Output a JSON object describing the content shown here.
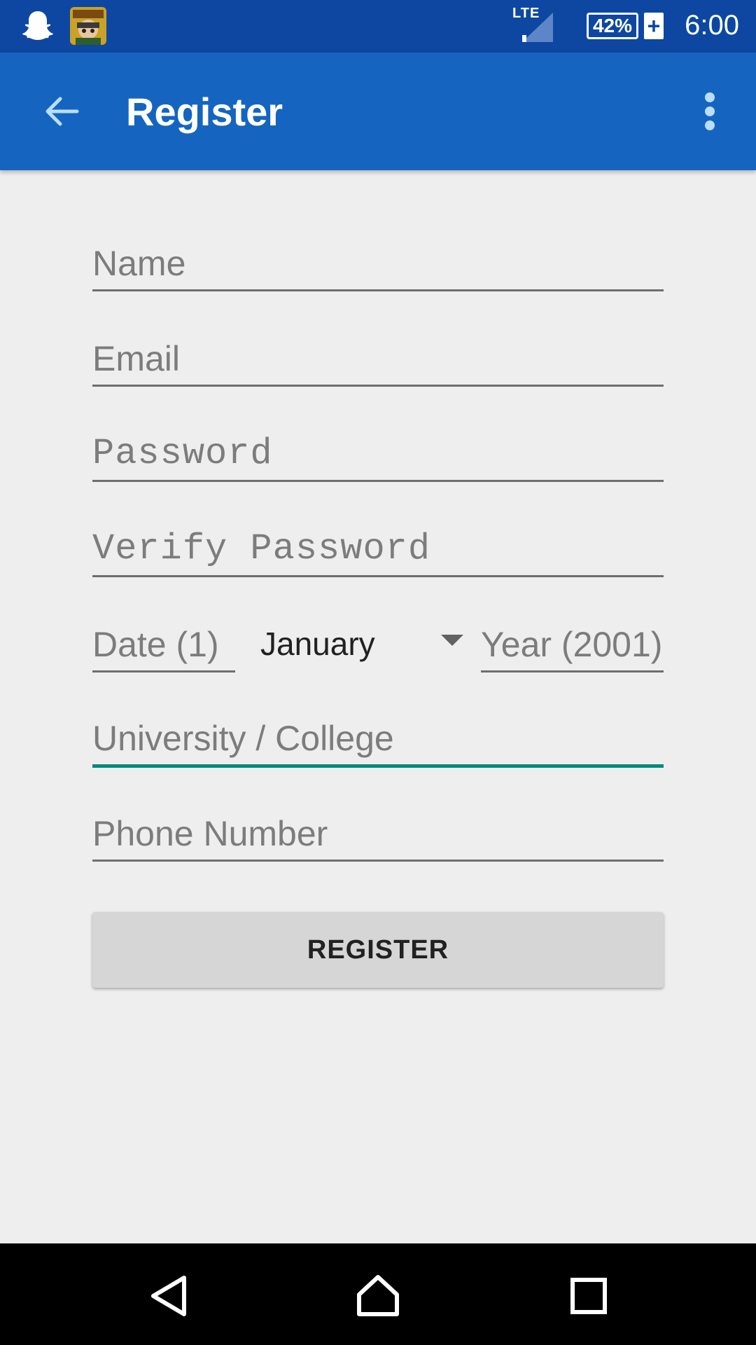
{
  "status_bar": {
    "network_label": "LTE",
    "battery_text": "42%",
    "battery_charging_symbol": "+",
    "time": "6:00",
    "icons": [
      "snapchat-icon",
      "game-app-icon",
      "signal-icon",
      "battery-icon"
    ]
  },
  "app_bar": {
    "title": "Register",
    "back_icon": "arrow-left-icon",
    "menu_icon": "more-vert-icon",
    "color": "#1565c0",
    "status_color": "#0d47a1"
  },
  "form": {
    "name": {
      "placeholder": "Name",
      "value": ""
    },
    "email": {
      "placeholder": "Email",
      "value": ""
    },
    "password": {
      "placeholder": "Password",
      "value": ""
    },
    "verify_password": {
      "placeholder": "Verify Password",
      "value": ""
    },
    "date": {
      "placeholder": "Date (1)",
      "value": ""
    },
    "month": {
      "selected": "January"
    },
    "year": {
      "placeholder": "Year (2001)",
      "value": ""
    },
    "university": {
      "placeholder": "University / College",
      "value": "",
      "focused": true
    },
    "phone": {
      "placeholder": "Phone Number",
      "value": ""
    },
    "focus_color": "#00897b"
  },
  "register_button": {
    "label": "REGISTER"
  },
  "nav_bar": {
    "icons": [
      "nav-back-icon",
      "nav-home-icon",
      "nav-recents-icon"
    ]
  }
}
